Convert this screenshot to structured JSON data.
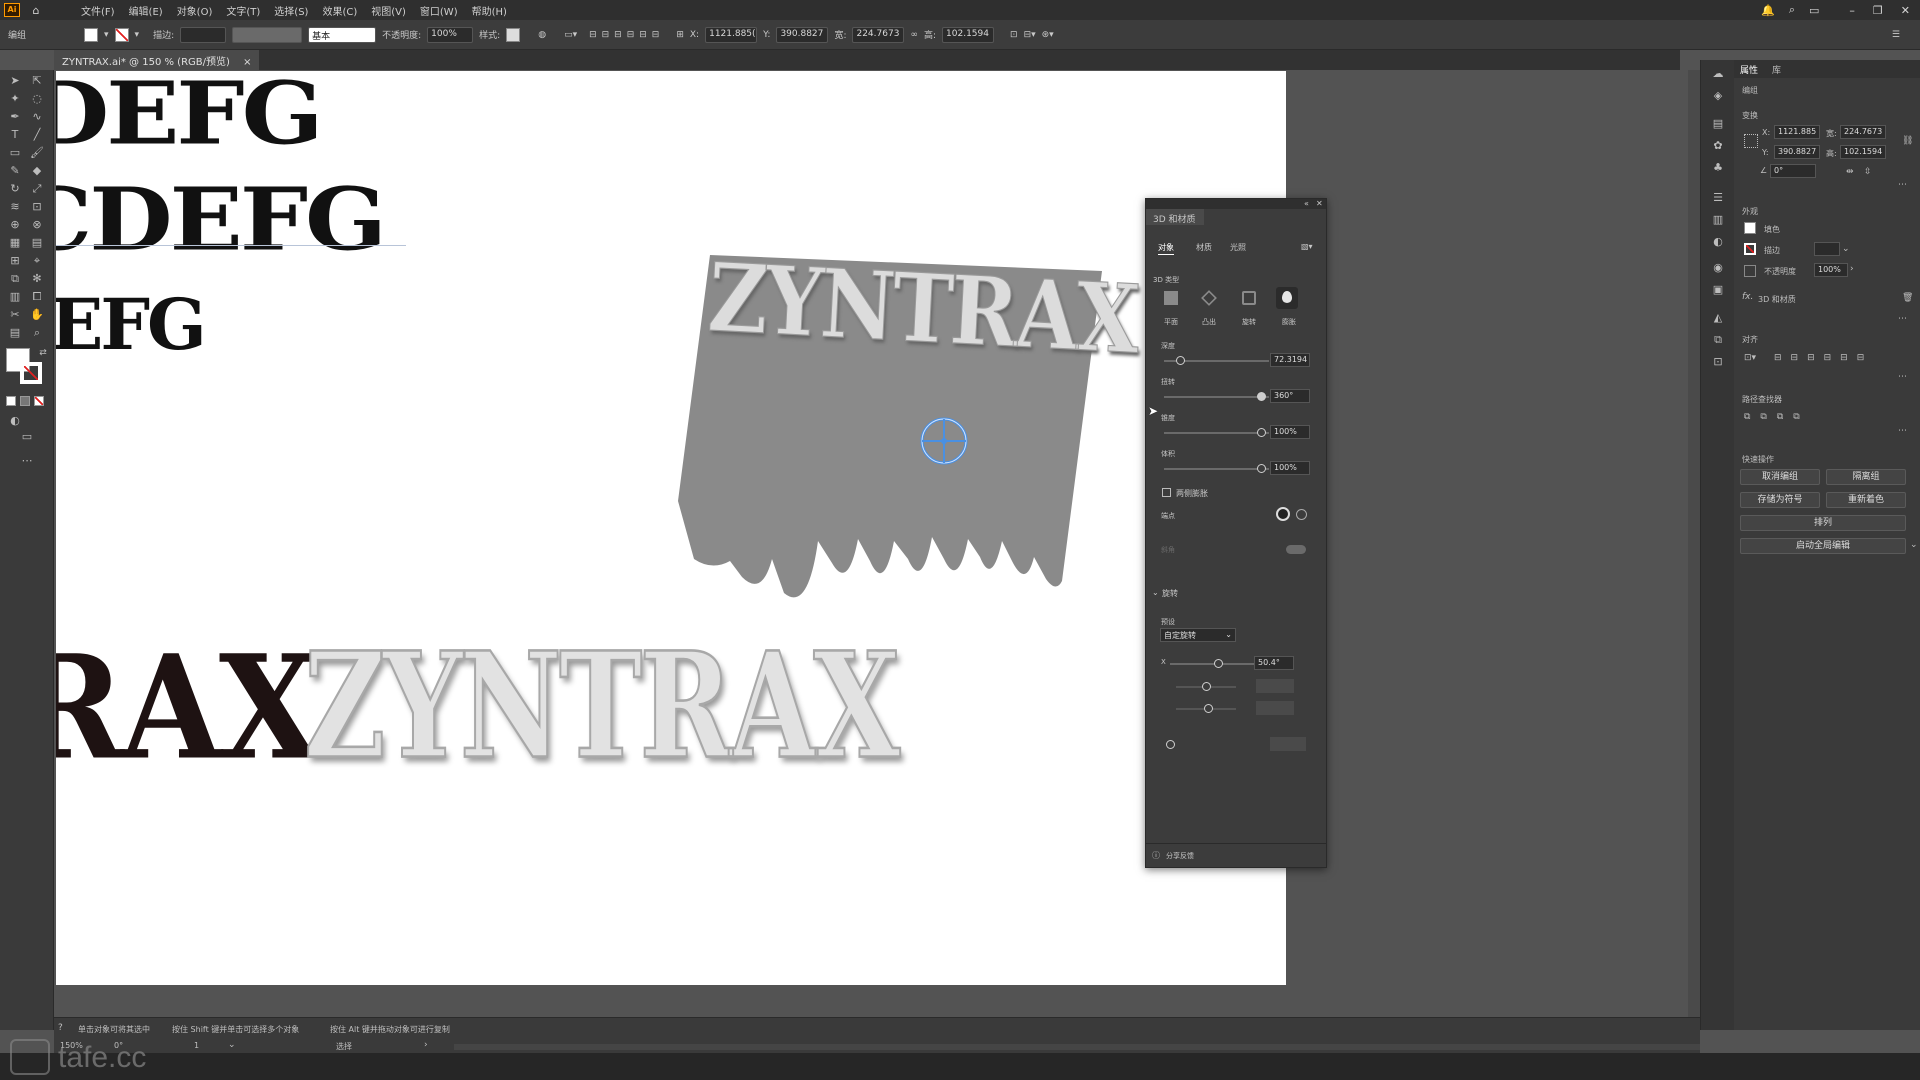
{
  "menubar": {
    "app_logo": "Ai",
    "items": [
      "文件(F)",
      "编辑(E)",
      "对象(O)",
      "文字(T)",
      "选择(S)",
      "效果(C)",
      "视图(V)",
      "窗口(W)",
      "帮助(H)"
    ]
  },
  "control_bar": {
    "group_label": "编组",
    "stroke_label": "描边:",
    "stroke_style": "基本",
    "opacity_label": "不透明度:",
    "opacity_value": "100%",
    "style_label": "样式:",
    "x_label": "X:",
    "x_value": "1121.885(",
    "y_label": "Y:",
    "y_value": "390.8827",
    "w_label": "宽:",
    "w_value": "224.7673",
    "h_label": "高:",
    "h_value": "102.1594"
  },
  "document_tab": {
    "title": "ZYNTRAX.ai* @ 150 % (RGB/预览)",
    "close_glyph": "×"
  },
  "artboard": {
    "text_row1": "DEFG",
    "text_row2": "CDEFG",
    "text_row3": "EFG",
    "text_row4": "RAX",
    "chrome_text": "ZYNTRAX",
    "extrude_text": "ZYNTRAX"
  },
  "panel_3d": {
    "title": "3D 和材质",
    "tabs": [
      "对象",
      "材质",
      "光照"
    ],
    "type_label": "3D 类型",
    "types": [
      "平面",
      "凸出",
      "旋转",
      "膨胀"
    ],
    "depth_label": "深度",
    "depth_value": "72.3194",
    "twist_label": "扭转",
    "twist_value": "360°",
    "taper_label": "锥度",
    "taper_value": "100%",
    "volume_label": "体积",
    "volume_value": "100%",
    "both_sides_label": "两侧膨胀",
    "cap_label": "端点",
    "bevel_label": "斜角",
    "rotation_section": "旋转",
    "preset_label": "预设",
    "preset_value": "自定旋转",
    "x_axis_label": "X",
    "x_rotation_value": "50.4°",
    "feedback_label": "分享反馈"
  },
  "properties": {
    "tabs": [
      "属性",
      "库"
    ],
    "selection_label": "编组",
    "transform_label": "变换",
    "x_label": "X:",
    "x_value": "1121.885",
    "y_label": "Y:",
    "y_value": "390.8827",
    "w_label": "宽:",
    "w_value": "224.7673",
    "h_label": "高:",
    "h_value": "102.1594",
    "angle_value": "0°",
    "appearance_label": "外观",
    "fill_label": "填色",
    "stroke_label": "描边",
    "opacity_label": "不透明度",
    "opacity_value": "100%",
    "fx_label": "3D 和材质",
    "align_label": "对齐",
    "pathfinder_label": "路径查找器",
    "quick_actions_label": "快速操作",
    "btn_ungroup": "取消编组",
    "btn_isolate": "隔离组",
    "btn_save_symbol": "存储为符号",
    "btn_recolor": "重新着色",
    "btn_arrange": "排列",
    "btn_global_edit": "启动全局编辑"
  },
  "status": {
    "hint1": "单击对象可将其选中",
    "hint2": "按住 Shift 键并单击可选择多个对象",
    "hint3": "按住 Alt 键并拖动对象可进行复制",
    "zoom": "150%",
    "rotation": "0°",
    "artboard_num": "1",
    "tool_name": "选择"
  },
  "watermark": "tafe.cc",
  "colors": {
    "chrome": "#535353",
    "panel": "#3c3c3c",
    "accent_target": "#4a90e2",
    "extrude_gray": "#8a8a8a"
  }
}
